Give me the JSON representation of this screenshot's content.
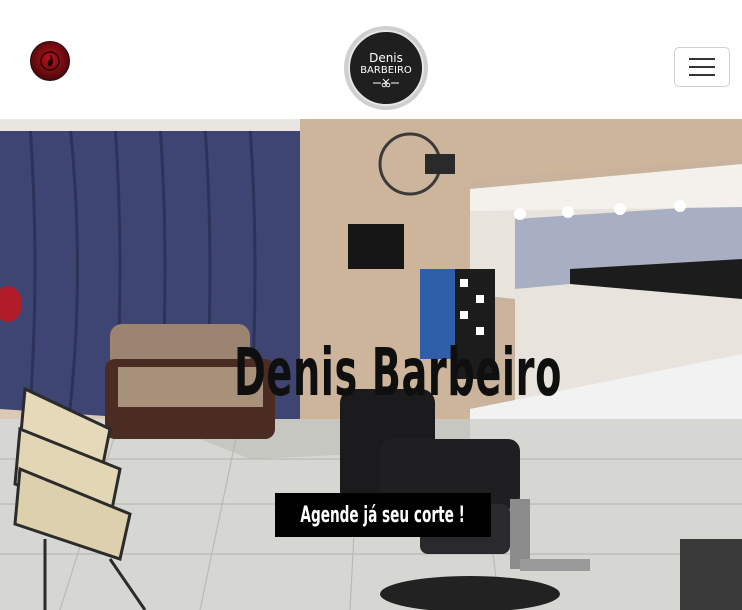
{
  "header": {
    "app_icon": "flame-badge-icon",
    "logo": {
      "line1": "Denis",
      "line2": "BARBEIRO",
      "icon": "scissors-icon"
    },
    "menu_icon": "hamburger-menu-icon"
  },
  "hero": {
    "title": "Denis Barbeiro",
    "cta_label": "Agende já seu corte !",
    "background": "barbershop-interior-photo"
  },
  "colors": {
    "header_bg": "#ffffff",
    "title": "#0f0f0f",
    "cta_bg": "#000000",
    "cta_text": "#ffffff"
  }
}
